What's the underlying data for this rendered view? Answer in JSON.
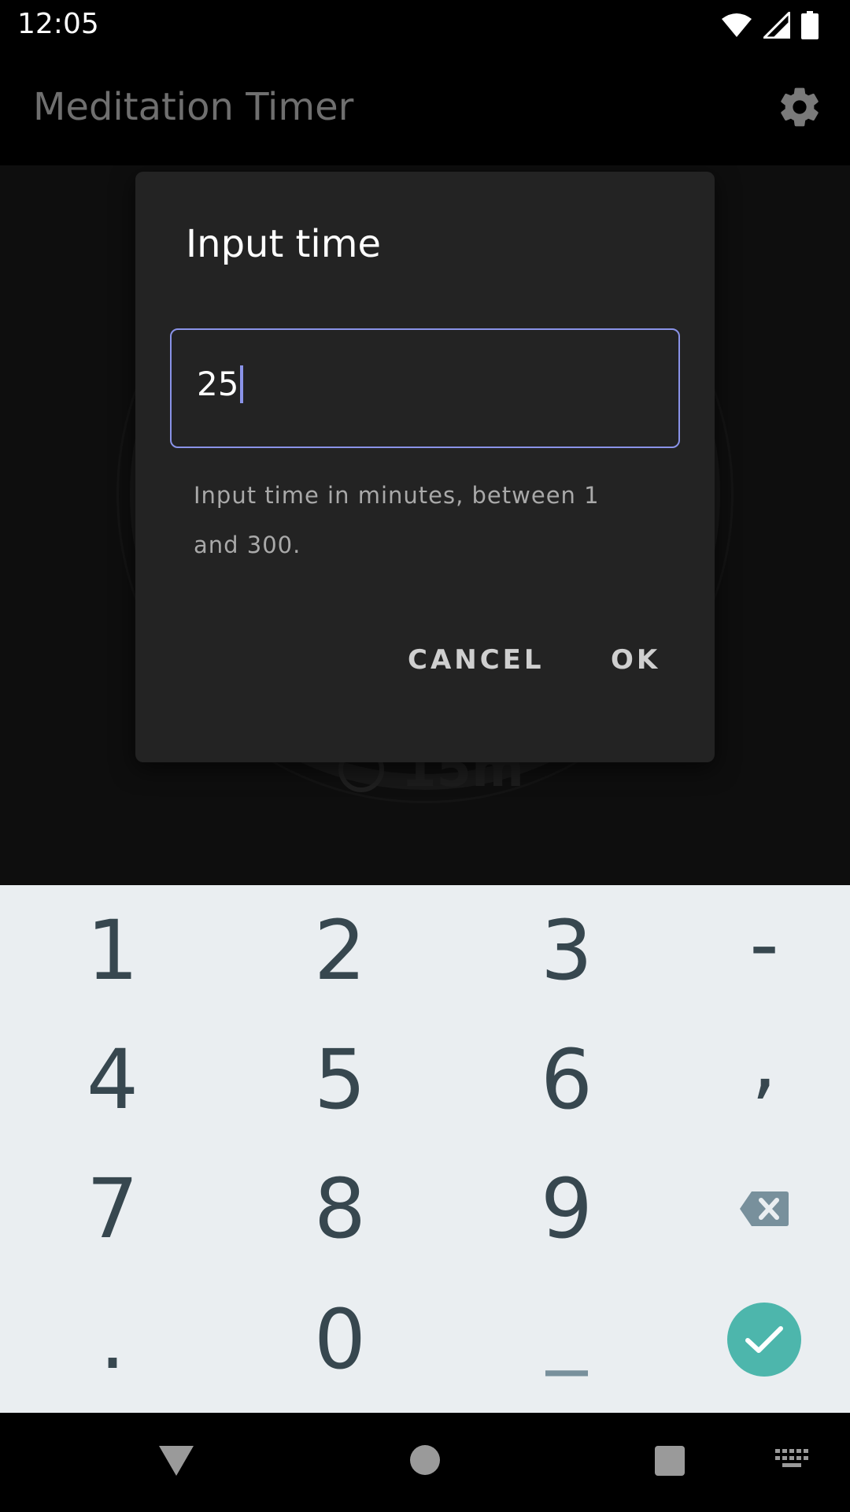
{
  "status_bar": {
    "time": "12:05"
  },
  "app_bar": {
    "title": "Meditation Timer"
  },
  "background": {
    "time_label": "15m"
  },
  "dialog": {
    "title": "Input time",
    "input_value": "25",
    "helper_text": "Input time in minutes, between 1 and 300.",
    "cancel_label": "CANCEL",
    "ok_label": "OK",
    "accent_color": "#8a93e8"
  },
  "keyboard": {
    "rows": [
      [
        "1",
        "2",
        "3",
        "-"
      ],
      [
        "4",
        "5",
        "6",
        ","
      ],
      [
        "7",
        "8",
        "9",
        "backspace-icon"
      ],
      [
        ".",
        "0",
        "_",
        "check-icon"
      ]
    ],
    "enter_color": "#4db6ac",
    "key_color": "#37474f"
  }
}
